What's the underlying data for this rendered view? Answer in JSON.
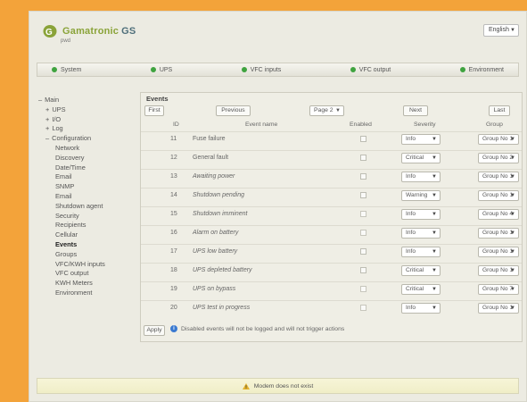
{
  "header": {
    "brand": "Gamatronic",
    "brand_suffix": "GS",
    "subtitle": "pwd",
    "language": "English"
  },
  "topnav": [
    {
      "label": "System",
      "status_color": "#3fa33f"
    },
    {
      "label": "UPS",
      "status_color": "#3fa33f"
    },
    {
      "label": "VFC inputs",
      "status_color": "#3fa33f"
    },
    {
      "label": "VFC output",
      "status_color": "#3fa33f"
    },
    {
      "label": "Environment",
      "status_color": "#3fa33f"
    }
  ],
  "sidebar": [
    {
      "label": "Main",
      "level": 0,
      "prefix": "–",
      "active": false
    },
    {
      "label": "UPS",
      "level": 1,
      "prefix": "+",
      "active": false
    },
    {
      "label": "I/O",
      "level": 1,
      "prefix": "+",
      "active": false
    },
    {
      "label": "Log",
      "level": 1,
      "prefix": "+",
      "active": false
    },
    {
      "label": "Configuration",
      "level": 1,
      "prefix": "–",
      "active": false
    },
    {
      "label": "Network",
      "level": 2,
      "prefix": "",
      "active": false
    },
    {
      "label": "Discovery",
      "level": 2,
      "prefix": "",
      "active": false
    },
    {
      "label": "Date/Time",
      "level": 2,
      "prefix": "",
      "active": false
    },
    {
      "label": "Email",
      "level": 2,
      "prefix": "",
      "active": false
    },
    {
      "label": "SNMP",
      "level": 2,
      "prefix": "",
      "active": false
    },
    {
      "label": "Email",
      "level": 2,
      "prefix": "",
      "active": false
    },
    {
      "label": "Shutdown agent",
      "level": 2,
      "prefix": "",
      "active": false
    },
    {
      "label": "Security",
      "level": 2,
      "prefix": "",
      "active": false
    },
    {
      "label": "Recipients",
      "level": 2,
      "prefix": "",
      "active": false
    },
    {
      "label": "Cellular",
      "level": 2,
      "prefix": "",
      "active": false
    },
    {
      "label": "Events",
      "level": 2,
      "prefix": "",
      "active": true
    },
    {
      "label": "Groups",
      "level": 2,
      "prefix": "",
      "active": false
    },
    {
      "label": "VFC/KWH inputs",
      "level": 2,
      "prefix": "",
      "active": false
    },
    {
      "label": "VFC output",
      "level": 2,
      "prefix": "",
      "active": false
    },
    {
      "label": "KWH Meters",
      "level": 2,
      "prefix": "",
      "active": false
    },
    {
      "label": "Environment",
      "level": 2,
      "prefix": "",
      "active": false
    }
  ],
  "events": {
    "title": "Events",
    "buttons": {
      "first": "First",
      "previous": "Previous",
      "page_value": "Page 2",
      "next": "Next",
      "last": "Last",
      "apply": "Apply"
    },
    "columns": {
      "id": "ID",
      "name": "Event name",
      "enabled": "Enabled",
      "severity": "Severity",
      "group": "Group"
    },
    "rows": [
      {
        "id": "11",
        "name": "Fuse failure",
        "enabled": true,
        "severity": "Info",
        "group": "Group No 1",
        "italic": false
      },
      {
        "id": "12",
        "name": "General fault",
        "enabled": true,
        "severity": "Critical",
        "group": "Group No 2",
        "italic": false
      },
      {
        "id": "13",
        "name": "Awaiting power",
        "enabled": true,
        "severity": "Info",
        "group": "Group No 1",
        "italic": true
      },
      {
        "id": "14",
        "name": "Shutdown pending",
        "enabled": true,
        "severity": "Warning",
        "group": "Group No 1",
        "italic": true
      },
      {
        "id": "15",
        "name": "Shutdown imminent",
        "enabled": false,
        "severity": "Info",
        "group": "Group No 4",
        "italic": true
      },
      {
        "id": "16",
        "name": "Alarm on battery",
        "enabled": false,
        "severity": "Info",
        "group": "Group No 1",
        "italic": true
      },
      {
        "id": "17",
        "name": "UPS low battery",
        "enabled": true,
        "severity": "Info",
        "group": "Group No 1",
        "italic": true
      },
      {
        "id": "18",
        "name": "UPS depleted battery",
        "enabled": true,
        "severity": "Critical",
        "group": "Group No 1",
        "italic": true
      },
      {
        "id": "19",
        "name": "UPS on bypass",
        "enabled": false,
        "severity": "Critical",
        "group": "Group No 7",
        "italic": true
      },
      {
        "id": "20",
        "name": "UPS test in progress",
        "enabled": false,
        "severity": "Info",
        "group": "Group No 1",
        "italic": true
      }
    ],
    "info_text": "Disabled events will not be logged and will not trigger actions"
  },
  "status": {
    "message": "Modem does not exist"
  }
}
